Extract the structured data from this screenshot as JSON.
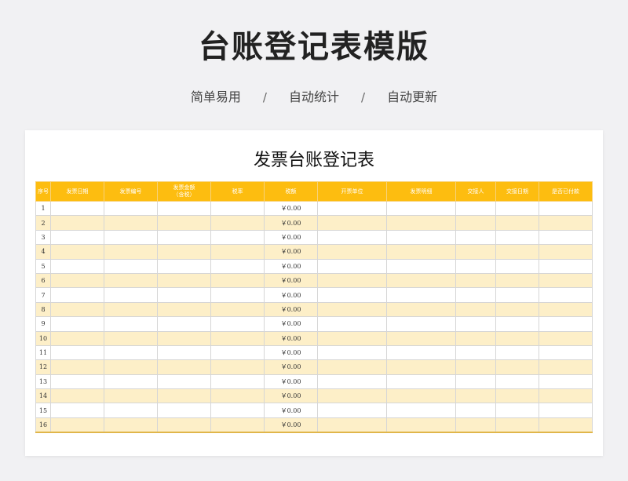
{
  "header": {
    "title": "台账登记表模版",
    "features": [
      "简单易用",
      "自动统计",
      "自动更新"
    ],
    "separator": "/"
  },
  "sheet": {
    "title": "发票台账登记表",
    "columns": [
      "序号",
      "发票日期",
      "发票编号",
      "发票金额\n（含税）",
      "税率",
      "税额",
      "开票单位",
      "发票明细",
      "交接人",
      "交接日期",
      "是否已付款"
    ],
    "rows": [
      {
        "no": "1",
        "tax_amount": "￥0.00"
      },
      {
        "no": "2",
        "tax_amount": "￥0.00"
      },
      {
        "no": "3",
        "tax_amount": "￥0.00"
      },
      {
        "no": "4",
        "tax_amount": "￥0.00"
      },
      {
        "no": "5",
        "tax_amount": "￥0.00"
      },
      {
        "no": "6",
        "tax_amount": "￥0.00"
      },
      {
        "no": "7",
        "tax_amount": "￥0.00"
      },
      {
        "no": "8",
        "tax_amount": "￥0.00"
      },
      {
        "no": "9",
        "tax_amount": "￥0.00"
      },
      {
        "no": "10",
        "tax_amount": "￥0.00"
      },
      {
        "no": "11",
        "tax_amount": "￥0.00"
      },
      {
        "no": "12",
        "tax_amount": "￥0.00"
      },
      {
        "no": "13",
        "tax_amount": "￥0.00"
      },
      {
        "no": "14",
        "tax_amount": "￥0.00"
      },
      {
        "no": "15",
        "tax_amount": "￥0.00"
      },
      {
        "no": "16",
        "tax_amount": "￥0.00"
      }
    ]
  },
  "colors": {
    "header_fill": "#fdbd10",
    "band_fill": "#fdefc8",
    "page_bg": "#f1f1f3"
  }
}
